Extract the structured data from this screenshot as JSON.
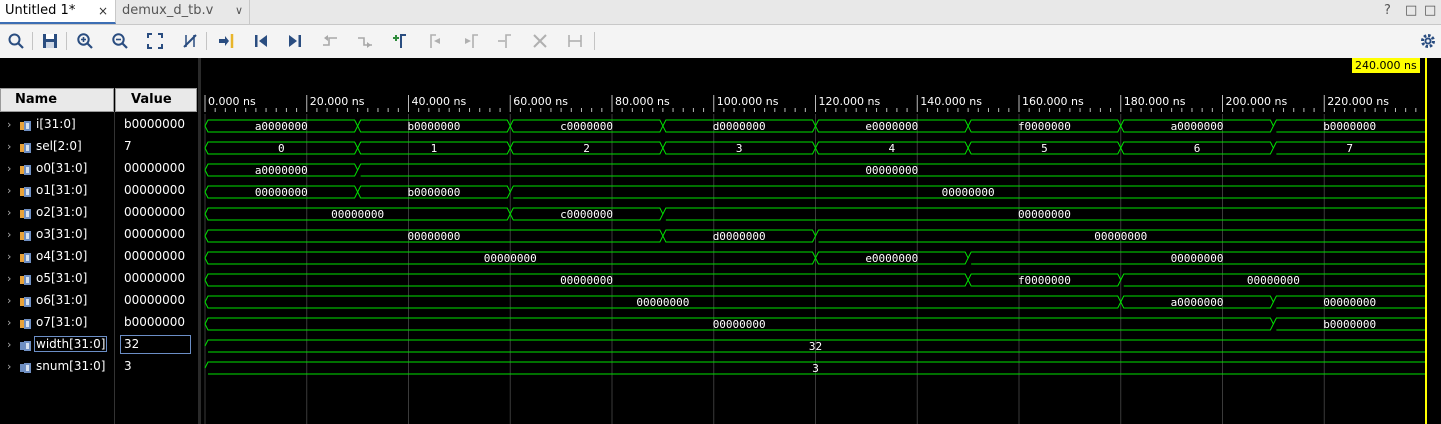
{
  "tabs": [
    {
      "label": "Untitled 1*",
      "close": "×"
    },
    {
      "label": "demux_d_tb.v",
      "dropdown": "∨"
    }
  ],
  "window_controls": [
    "?",
    "□",
    "□"
  ],
  "toolbar": {
    "icons": [
      "search-icon",
      "save-icon",
      "zoom-in-icon",
      "zoom-out-icon",
      "zoom-fit-icon",
      "swap-cursor-icon",
      "go-to-cursor-icon",
      "go-to-start-icon",
      "go-to-end-icon",
      "previous-transition-icon",
      "next-transition-icon",
      "add-marker-icon",
      "previous-marker-icon",
      "next-marker-icon",
      "swap-marker-icon",
      "delete-marker-icon",
      "measure-icon",
      "settings-icon"
    ]
  },
  "columns": {
    "name": "Name",
    "value": "Value"
  },
  "signals": [
    {
      "name": "i[31:0]",
      "value": "b0000000",
      "icon": "bus"
    },
    {
      "name": "sel[2:0]",
      "value": "7",
      "icon": "bus"
    },
    {
      "name": "o0[31:0]",
      "value": "00000000",
      "icon": "bus"
    },
    {
      "name": "o1[31:0]",
      "value": "00000000",
      "icon": "bus"
    },
    {
      "name": "o2[31:0]",
      "value": "00000000",
      "icon": "bus"
    },
    {
      "name": "o3[31:0]",
      "value": "00000000",
      "icon": "bus"
    },
    {
      "name": "o4[31:0]",
      "value": "00000000",
      "icon": "bus"
    },
    {
      "name": "o5[31:0]",
      "value": "00000000",
      "icon": "bus"
    },
    {
      "name": "o6[31:0]",
      "value": "00000000",
      "icon": "bus"
    },
    {
      "name": "o7[31:0]",
      "value": "b0000000",
      "icon": "bus"
    },
    {
      "name": "width[31:0]",
      "value": "32",
      "icon": "param",
      "selected": true
    },
    {
      "name": "snum[31:0]",
      "value": "3",
      "icon": "param"
    }
  ],
  "timeline": {
    "unit": "ns",
    "start": 0,
    "end": 240,
    "major_step": 20,
    "tick_labels": [
      "0.000 ns",
      "20.000 ns",
      "40.000 ns",
      "60.000 ns",
      "80.000 ns",
      "100.000 ns",
      "120.000 ns",
      "140.000 ns",
      "160.000 ns",
      "180.000 ns",
      "200.000 ns",
      "220.000 ns"
    ],
    "cursor_ns": 240,
    "cursor_label": "240.000 ns"
  },
  "waveforms": [
    {
      "signal": "i[31:0]",
      "segments": [
        [
          0,
          30,
          "a0000000"
        ],
        [
          30,
          60,
          "b0000000"
        ],
        [
          60,
          90,
          "c0000000"
        ],
        [
          90,
          120,
          "d0000000"
        ],
        [
          120,
          150,
          "e0000000"
        ],
        [
          150,
          180,
          "f0000000"
        ],
        [
          180,
          210,
          "a0000000"
        ],
        [
          210,
          240,
          "b0000000"
        ]
      ]
    },
    {
      "signal": "sel[2:0]",
      "segments": [
        [
          0,
          30,
          "0"
        ],
        [
          30,
          60,
          "1"
        ],
        [
          60,
          90,
          "2"
        ],
        [
          90,
          120,
          "3"
        ],
        [
          120,
          150,
          "4"
        ],
        [
          150,
          180,
          "5"
        ],
        [
          180,
          210,
          "6"
        ],
        [
          210,
          240,
          "7"
        ]
      ]
    },
    {
      "signal": "o0[31:0]",
      "segments": [
        [
          0,
          30,
          "a0000000"
        ],
        [
          30,
          240,
          "00000000"
        ]
      ]
    },
    {
      "signal": "o1[31:0]",
      "segments": [
        [
          0,
          30,
          "00000000"
        ],
        [
          30,
          60,
          "b0000000"
        ],
        [
          60,
          240,
          "00000000"
        ]
      ]
    },
    {
      "signal": "o2[31:0]",
      "segments": [
        [
          0,
          60,
          "00000000"
        ],
        [
          60,
          90,
          "c0000000"
        ],
        [
          90,
          240,
          "00000000"
        ]
      ]
    },
    {
      "signal": "o3[31:0]",
      "segments": [
        [
          0,
          90,
          "00000000"
        ],
        [
          90,
          120,
          "d0000000"
        ],
        [
          120,
          240,
          "00000000"
        ]
      ]
    },
    {
      "signal": "o4[31:0]",
      "segments": [
        [
          0,
          120,
          "00000000"
        ],
        [
          120,
          150,
          "e0000000"
        ],
        [
          150,
          240,
          "00000000"
        ]
      ]
    },
    {
      "signal": "o5[31:0]",
      "segments": [
        [
          0,
          150,
          "00000000"
        ],
        [
          150,
          180,
          "f0000000"
        ],
        [
          180,
          240,
          "00000000"
        ]
      ]
    },
    {
      "signal": "o6[31:0]",
      "segments": [
        [
          0,
          180,
          "00000000"
        ],
        [
          180,
          210,
          "a0000000"
        ],
        [
          210,
          240,
          "00000000"
        ]
      ]
    },
    {
      "signal": "o7[31:0]",
      "segments": [
        [
          0,
          210,
          "00000000"
        ],
        [
          210,
          240,
          "b0000000"
        ]
      ]
    },
    {
      "signal": "width[31:0]",
      "segments": [
        [
          0,
          240,
          "32"
        ]
      ]
    },
    {
      "signal": "snum[31:0]",
      "segments": [
        [
          0,
          240,
          "3"
        ]
      ]
    }
  ],
  "colors": {
    "wave": "#00e000",
    "cursor": "#ffff00",
    "background": "#000000",
    "grid": "#3a3a3a",
    "text": "#ffffff",
    "bus_icon_a": "#e8a23a",
    "bus_icon_b": "#6f8fc2"
  }
}
